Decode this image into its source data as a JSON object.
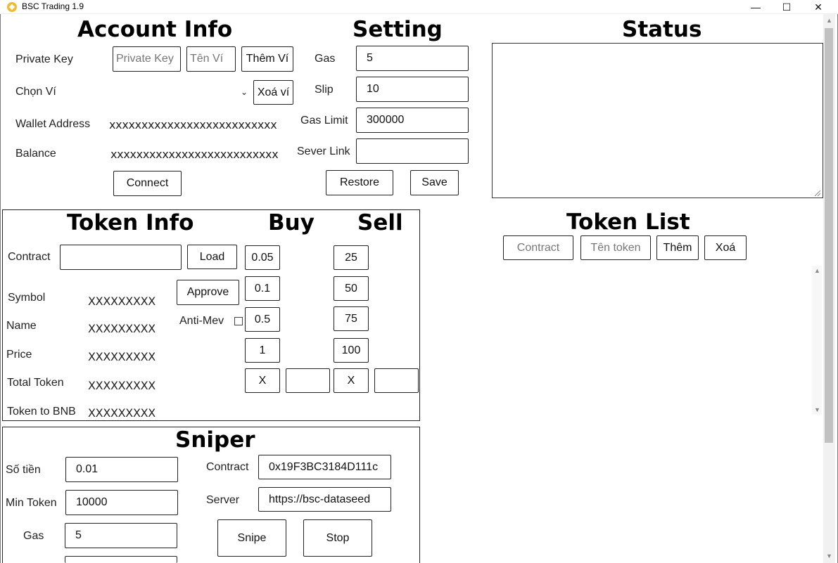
{
  "window": {
    "title": "BSC Trading 1.9",
    "minimize": "—",
    "maximize": "☐",
    "close": "✕"
  },
  "account": {
    "heading": "Account Info",
    "private_key_label": "Private Key",
    "private_key_placeholder": "Private Key",
    "wallet_name_placeholder": "Tên Ví",
    "add_wallet": "Thêm Ví",
    "choose_wallet": "Chọn Ví",
    "delete_wallet": "Xoá ví",
    "wallet_address_label": "Wallet Address",
    "wallet_address_value": "xxxxxxxxxxxxxxxxxxxxxxxxxx",
    "balance_label": "Balance",
    "balance_value": "xxxxxxxxxxxxxxxxxxxxxxxxxx",
    "connect": "Connect"
  },
  "setting": {
    "heading": "Setting",
    "gas_label": "Gas",
    "gas_value": "5",
    "slip_label": "Slip",
    "slip_value": "10",
    "gas_limit_label": "Gas Limit",
    "gas_limit_value": "300000",
    "server_link_label": "Sever Link",
    "server_link_value": "",
    "restore": "Restore",
    "save": "Save"
  },
  "status": {
    "heading": "Status",
    "content": ""
  },
  "token_info": {
    "heading": "Token Info",
    "buy_heading": "Buy",
    "sell_heading": "Sell",
    "contract_label": "Contract",
    "contract_value": "",
    "load": "Load",
    "approve": "Approve",
    "anti_mev": "Anti-Mev",
    "rows": [
      {
        "label": "Symbol",
        "value": "XXXXXXXXX"
      },
      {
        "label": "Name",
        "value": "XXXXXXXXX"
      },
      {
        "label": "Price",
        "value": "XXXXXXXXX"
      },
      {
        "label": "Total Token",
        "value": "XXXXXXXXX"
      },
      {
        "label": "Token to BNB",
        "value": "XXXXXXXXX"
      }
    ],
    "buy_amounts": [
      "0.05",
      "0.1",
      "0.5",
      "1"
    ],
    "sell_percents": [
      "25",
      "50",
      "75",
      "100"
    ],
    "buy_custom_x": "X",
    "buy_custom_value": "",
    "sell_custom_x": "X",
    "sell_custom_value": ""
  },
  "token_list": {
    "heading": "Token List",
    "contract_placeholder": "Contract",
    "token_name_placeholder": "Tên token",
    "add": "Thêm",
    "delete": "Xoá"
  },
  "sniper": {
    "heading": "Sniper",
    "amount_label": "Số tiền",
    "amount_value": "0.01",
    "min_token_label": "Min Token",
    "min_token_value": "10000",
    "gas_label": "Gas",
    "gas_value": "5",
    "contract_label": "Contract",
    "contract_value": "0x19F3BC3184D111c",
    "server_label": "Server",
    "server_value": "https://bsc-dataseed",
    "snipe": "Snipe",
    "stop": "Stop"
  }
}
